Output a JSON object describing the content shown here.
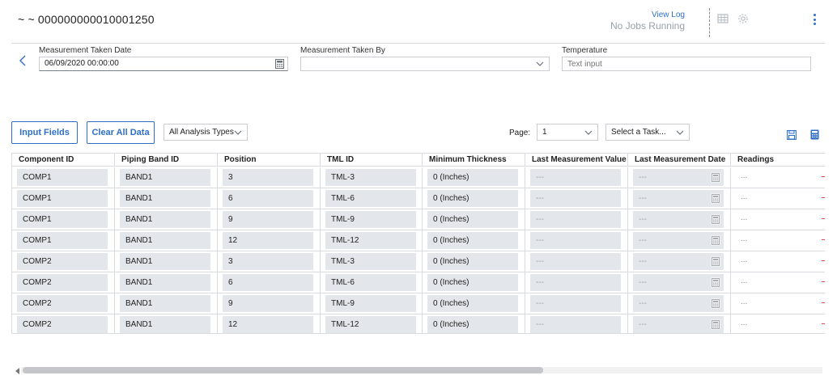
{
  "header": {
    "title": "~ ~ 000000000010001250",
    "view_log": "View Log",
    "jobs_status": "No Jobs Running"
  },
  "form": {
    "date_label": "Measurement Taken Date",
    "date_value": "06/09/2020 00:00:00",
    "taken_by_label": "Measurement Taken By",
    "taken_by_value": "",
    "temperature_label": "Temperature",
    "temperature_placeholder": "Text input"
  },
  "toolbar": {
    "input_fields_label": "Input Fields",
    "clear_all_label": "Clear All Data",
    "analysis_types_value": "All Analysis Types",
    "page_label": "Page:",
    "page_value": "1",
    "task_value": "Select a Task..."
  },
  "table": {
    "columns": [
      "Component ID",
      "Piping Band ID",
      "Position",
      "TML ID",
      "Minimum Thickness",
      "Last Measurement Value",
      "Last Measurement Date",
      "Readings"
    ],
    "rows": [
      {
        "component": "COMP1",
        "band": "BAND1",
        "position": "3",
        "tml": "TML-3",
        "min_thickness": "0 (Inches)",
        "last_value": "---",
        "last_date": "---",
        "readings": "..."
      },
      {
        "component": "COMP1",
        "band": "BAND1",
        "position": "6",
        "tml": "TML-6",
        "min_thickness": "0 (Inches)",
        "last_value": "---",
        "last_date": "---",
        "readings": "..."
      },
      {
        "component": "COMP1",
        "band": "BAND1",
        "position": "9",
        "tml": "TML-9",
        "min_thickness": "0 (Inches)",
        "last_value": "---",
        "last_date": "---",
        "readings": "..."
      },
      {
        "component": "COMP1",
        "band": "BAND1",
        "position": "12",
        "tml": "TML-12",
        "min_thickness": "0 (Inches)",
        "last_value": "---",
        "last_date": "---",
        "readings": "..."
      },
      {
        "component": "COMP2",
        "band": "BAND1",
        "position": "3",
        "tml": "TML-3",
        "min_thickness": "0 (Inches)",
        "last_value": "---",
        "last_date": "---",
        "readings": "..."
      },
      {
        "component": "COMP2",
        "band": "BAND1",
        "position": "6",
        "tml": "TML-6",
        "min_thickness": "0 (Inches)",
        "last_value": "---",
        "last_date": "---",
        "readings": "..."
      },
      {
        "component": "COMP2",
        "band": "BAND1",
        "position": "9",
        "tml": "TML-9",
        "min_thickness": "0 (Inches)",
        "last_value": "---",
        "last_date": "---",
        "readings": "..."
      },
      {
        "component": "COMP2",
        "band": "BAND1",
        "position": "12",
        "tml": "TML-12",
        "min_thickness": "0 (Inches)",
        "last_value": "---",
        "last_date": "---",
        "readings": "..."
      }
    ]
  },
  "colors": {
    "accent": "#2e6fc6",
    "cell_fill": "#e3e6ea",
    "border": "#d8dce0",
    "marker_red": "#e04848"
  },
  "icons": [
    "table-icon",
    "gear-icon",
    "more-vertical-icon",
    "chevron-left-icon",
    "calendar-icon",
    "chevron-down-icon",
    "save-icon",
    "calculator-icon"
  ]
}
